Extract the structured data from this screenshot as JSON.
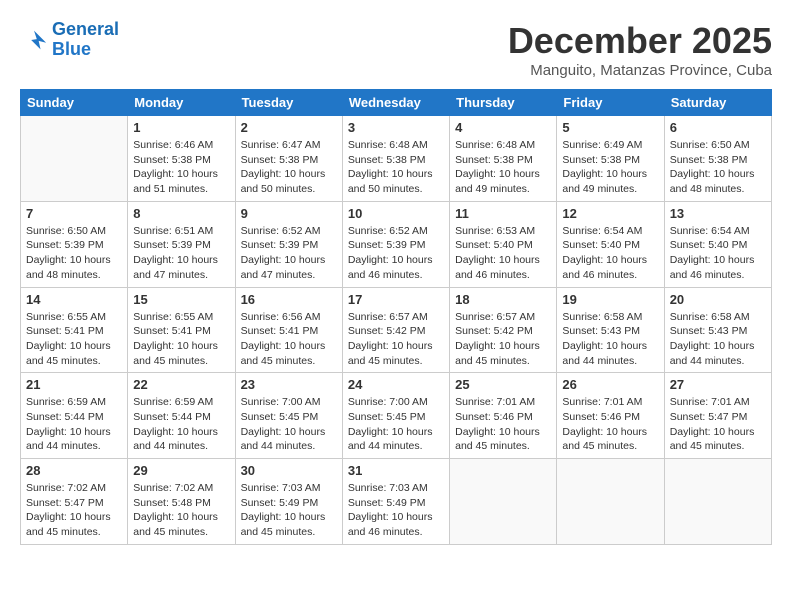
{
  "header": {
    "logo_line1": "General",
    "logo_line2": "Blue",
    "month_title": "December 2025",
    "location": "Manguito, Matanzas Province, Cuba"
  },
  "days_of_week": [
    "Sunday",
    "Monday",
    "Tuesday",
    "Wednesday",
    "Thursday",
    "Friday",
    "Saturday"
  ],
  "weeks": [
    [
      {
        "day": "",
        "info": ""
      },
      {
        "day": "1",
        "info": "Sunrise: 6:46 AM\nSunset: 5:38 PM\nDaylight: 10 hours\nand 51 minutes."
      },
      {
        "day": "2",
        "info": "Sunrise: 6:47 AM\nSunset: 5:38 PM\nDaylight: 10 hours\nand 50 minutes."
      },
      {
        "day": "3",
        "info": "Sunrise: 6:48 AM\nSunset: 5:38 PM\nDaylight: 10 hours\nand 50 minutes."
      },
      {
        "day": "4",
        "info": "Sunrise: 6:48 AM\nSunset: 5:38 PM\nDaylight: 10 hours\nand 49 minutes."
      },
      {
        "day": "5",
        "info": "Sunrise: 6:49 AM\nSunset: 5:38 PM\nDaylight: 10 hours\nand 49 minutes."
      },
      {
        "day": "6",
        "info": "Sunrise: 6:50 AM\nSunset: 5:38 PM\nDaylight: 10 hours\nand 48 minutes."
      }
    ],
    [
      {
        "day": "7",
        "info": "Sunrise: 6:50 AM\nSunset: 5:39 PM\nDaylight: 10 hours\nand 48 minutes."
      },
      {
        "day": "8",
        "info": "Sunrise: 6:51 AM\nSunset: 5:39 PM\nDaylight: 10 hours\nand 47 minutes."
      },
      {
        "day": "9",
        "info": "Sunrise: 6:52 AM\nSunset: 5:39 PM\nDaylight: 10 hours\nand 47 minutes."
      },
      {
        "day": "10",
        "info": "Sunrise: 6:52 AM\nSunset: 5:39 PM\nDaylight: 10 hours\nand 46 minutes."
      },
      {
        "day": "11",
        "info": "Sunrise: 6:53 AM\nSunset: 5:40 PM\nDaylight: 10 hours\nand 46 minutes."
      },
      {
        "day": "12",
        "info": "Sunrise: 6:54 AM\nSunset: 5:40 PM\nDaylight: 10 hours\nand 46 minutes."
      },
      {
        "day": "13",
        "info": "Sunrise: 6:54 AM\nSunset: 5:40 PM\nDaylight: 10 hours\nand 46 minutes."
      }
    ],
    [
      {
        "day": "14",
        "info": "Sunrise: 6:55 AM\nSunset: 5:41 PM\nDaylight: 10 hours\nand 45 minutes."
      },
      {
        "day": "15",
        "info": "Sunrise: 6:55 AM\nSunset: 5:41 PM\nDaylight: 10 hours\nand 45 minutes."
      },
      {
        "day": "16",
        "info": "Sunrise: 6:56 AM\nSunset: 5:41 PM\nDaylight: 10 hours\nand 45 minutes."
      },
      {
        "day": "17",
        "info": "Sunrise: 6:57 AM\nSunset: 5:42 PM\nDaylight: 10 hours\nand 45 minutes."
      },
      {
        "day": "18",
        "info": "Sunrise: 6:57 AM\nSunset: 5:42 PM\nDaylight: 10 hours\nand 45 minutes."
      },
      {
        "day": "19",
        "info": "Sunrise: 6:58 AM\nSunset: 5:43 PM\nDaylight: 10 hours\nand 44 minutes."
      },
      {
        "day": "20",
        "info": "Sunrise: 6:58 AM\nSunset: 5:43 PM\nDaylight: 10 hours\nand 44 minutes."
      }
    ],
    [
      {
        "day": "21",
        "info": "Sunrise: 6:59 AM\nSunset: 5:44 PM\nDaylight: 10 hours\nand 44 minutes."
      },
      {
        "day": "22",
        "info": "Sunrise: 6:59 AM\nSunset: 5:44 PM\nDaylight: 10 hours\nand 44 minutes."
      },
      {
        "day": "23",
        "info": "Sunrise: 7:00 AM\nSunset: 5:45 PM\nDaylight: 10 hours\nand 44 minutes."
      },
      {
        "day": "24",
        "info": "Sunrise: 7:00 AM\nSunset: 5:45 PM\nDaylight: 10 hours\nand 44 minutes."
      },
      {
        "day": "25",
        "info": "Sunrise: 7:01 AM\nSunset: 5:46 PM\nDaylight: 10 hours\nand 45 minutes."
      },
      {
        "day": "26",
        "info": "Sunrise: 7:01 AM\nSunset: 5:46 PM\nDaylight: 10 hours\nand 45 minutes."
      },
      {
        "day": "27",
        "info": "Sunrise: 7:01 AM\nSunset: 5:47 PM\nDaylight: 10 hours\nand 45 minutes."
      }
    ],
    [
      {
        "day": "28",
        "info": "Sunrise: 7:02 AM\nSunset: 5:47 PM\nDaylight: 10 hours\nand 45 minutes."
      },
      {
        "day": "29",
        "info": "Sunrise: 7:02 AM\nSunset: 5:48 PM\nDaylight: 10 hours\nand 45 minutes."
      },
      {
        "day": "30",
        "info": "Sunrise: 7:03 AM\nSunset: 5:49 PM\nDaylight: 10 hours\nand 45 minutes."
      },
      {
        "day": "31",
        "info": "Sunrise: 7:03 AM\nSunset: 5:49 PM\nDaylight: 10 hours\nand 46 minutes."
      },
      {
        "day": "",
        "info": ""
      },
      {
        "day": "",
        "info": ""
      },
      {
        "day": "",
        "info": ""
      }
    ]
  ]
}
